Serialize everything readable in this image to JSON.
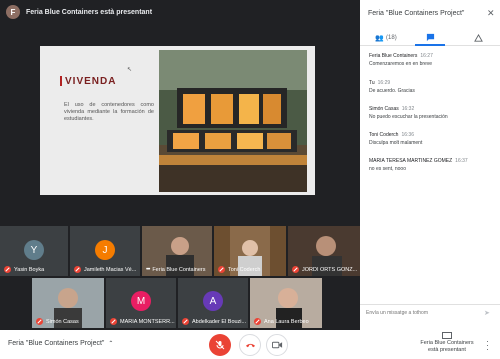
{
  "header": {
    "avatar_letter": "F",
    "title": "Feria Blue Containers està presentant"
  },
  "slide": {
    "logo": "VIVENDA",
    "text": "El uso de contenedores como vivienda mediante la formación de estudiantes."
  },
  "participants": [
    {
      "name": "Yasin Boyka",
      "letter": "Y",
      "color": "#607d8b"
    },
    {
      "name": "Jamileth Macias Vé...",
      "letter": "J",
      "color": "#f57c00"
    },
    {
      "name": "Feria Blue Containers",
      "letter": "",
      "color": ""
    },
    {
      "name": "Toni Coderch",
      "letter": "",
      "color": ""
    },
    {
      "name": "JORDI ORTS GONZ...",
      "letter": "",
      "color": ""
    },
    {
      "name": "Simón Casas",
      "letter": "",
      "color": ""
    },
    {
      "name": "MARIA MONTSERR...",
      "letter": "M",
      "color": "#e91e63"
    },
    {
      "name": "Abdelkader El Bouzi...",
      "letter": "A",
      "color": "#673ab7"
    },
    {
      "name": "Ana Laura Berbeo",
      "letter": "",
      "color": ""
    }
  ],
  "panel": {
    "title": "Feria \"Blue Containers Project\"",
    "people_count": "(18)",
    "messages": [
      {
        "sender": "Feria Blue Containers",
        "time": "16:27",
        "text": "Comenzaremos en en breve"
      },
      {
        "sender": "Tu",
        "time": "16:29",
        "text": "De acuerdo. Gracias"
      },
      {
        "sender": "Simón Casas",
        "time": "16:32",
        "text": "No puedo escuchar la presentación"
      },
      {
        "sender": "Toni Coderch",
        "time": "16:36",
        "text": "Disculpa molt malament"
      },
      {
        "sender": "MARIA TERESA MARTINEZ GOMEZ",
        "time": "16:37",
        "text": "no es sent, nooo"
      }
    ],
    "input_placeholder": "Envía un missatge a tothom"
  },
  "bottombar": {
    "meeting_name": "Feria \"Blue Containers Project\"",
    "present_label_1": "Feria Blue Containers",
    "present_label_2": "està presentant"
  },
  "colors": {
    "accent": "#1a73e8",
    "end_call": "#ea4335",
    "dark_bg": "#202124"
  }
}
